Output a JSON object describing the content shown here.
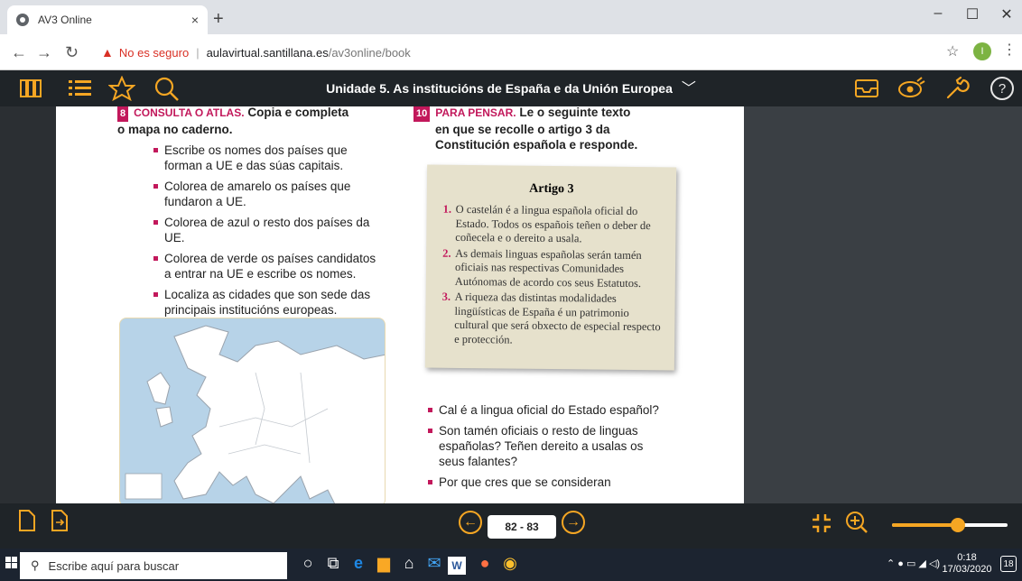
{
  "browser": {
    "tab_title": "AV3 Online",
    "tab_close": "×",
    "new_tab": "+",
    "insecure_label": "No es seguro",
    "url_host": "aulavirtual.santillana.es",
    "url_path": "/av3online/book",
    "profile_initial": "I",
    "window_controls": [
      "–",
      "☐",
      "✕"
    ]
  },
  "header": {
    "title": "Unidade 5. As institucións de España e da Unión Europea"
  },
  "exercise8": {
    "number": "8",
    "heading": "CONSULTA O ATLAS.",
    "heading_rest": "Copia e completa",
    "heading_line2": "o mapa no caderno.",
    "items": [
      "Escribe os nomes dos países que forman a UE e das súas capitais.",
      "Colorea de amarelo os países que fundaron a UE.",
      "Colorea de azul o resto dos países da UE.",
      "Colorea de verde os países candidatos a entrar na UE e escribe os nomes.",
      "Localiza as cidades que son sede das principais institucións europeas."
    ]
  },
  "exercise10": {
    "number": "10",
    "heading": "PARA PENSAR.",
    "heading_rest": "Le o seguinte texto",
    "heading_line2": "en que se recolle o artigo 3 da",
    "heading_line3": "Constitución española e responde.",
    "paper_title": "Artigo 3",
    "articles": [
      {
        "n": "1.",
        "text": "O castelán é a lingua española oficial do Estado. Todos os españois teñen o deber de coñecela e o dereito a usala."
      },
      {
        "n": "2.",
        "text": "As demais linguas españolas serán tamén oficiais nas respectivas Comunidades Autónomas de acordo cos seus Estatutos."
      },
      {
        "n": "3.",
        "text": "A riqueza das distintas modalidades lingüísticas de España é un patrimonio cultural que será obxecto de especial respecto e protección."
      }
    ],
    "questions": [
      "Cal é a lingua oficial do Estado español?",
      "Son tamén oficiais o resto de linguas españolas? Teñen dereito a usalas os seus falantes?",
      "Por que cres que se consideran"
    ]
  },
  "footer": {
    "page_label": "82 - 83",
    "zoom_level": 0.57
  },
  "taskbar": {
    "search_placeholder": "Escribe aquí para buscar",
    "time": "0:18",
    "date": "17/03/2020",
    "notifications": "18"
  },
  "colors": {
    "accent": "#f5a623",
    "exercise": "#c2185b",
    "appbar": "#1f2428"
  }
}
